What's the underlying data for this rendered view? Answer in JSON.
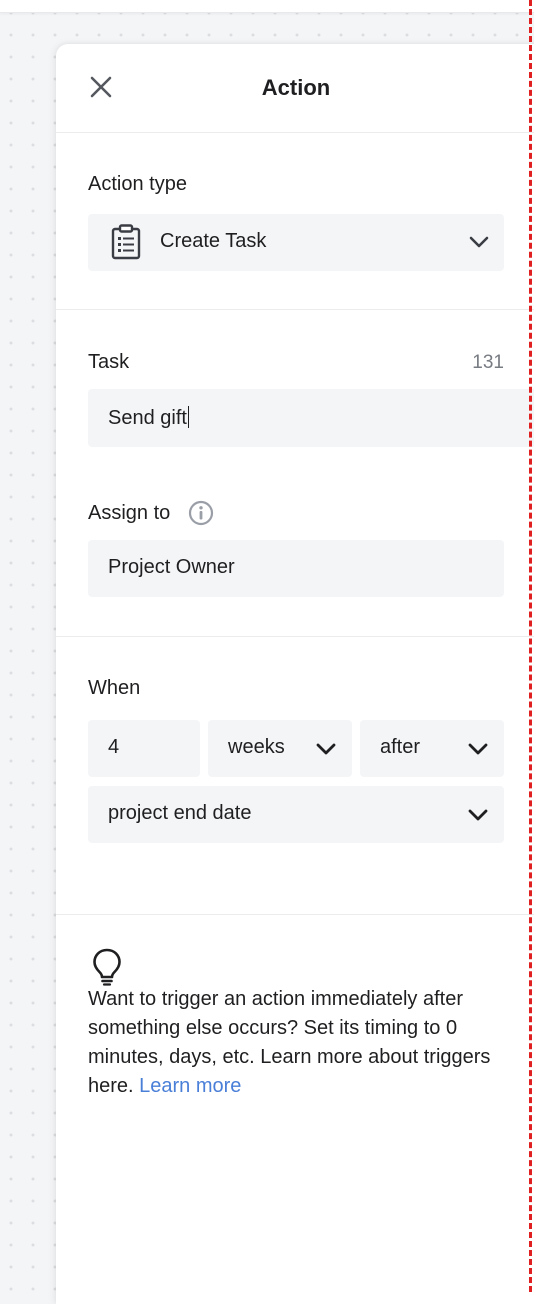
{
  "panel": {
    "title": "Action",
    "close_icon": "close-icon"
  },
  "action_type": {
    "label": "Action type",
    "value": "Create Task",
    "icon": "clipboard-icon"
  },
  "task": {
    "label": "Task",
    "counter": "131",
    "value": "Send gift"
  },
  "assign_to": {
    "label": "Assign to",
    "info_icon": "info-icon",
    "value": "Project Owner"
  },
  "when": {
    "label": "When",
    "amount": "4",
    "unit": "weeks",
    "relation": "after",
    "reference": "project end date"
  },
  "tip": {
    "icon": "lightbulb-icon",
    "text": "Want to trigger an action immediately after something else occurs? Set its timing to 0 minutes, days, etc. Learn more about triggers here.",
    "link_label": "Learn more"
  },
  "colors": {
    "link": "#4a7fd8",
    "guide_line": "#e02020",
    "field_bg": "#f4f5f7"
  }
}
